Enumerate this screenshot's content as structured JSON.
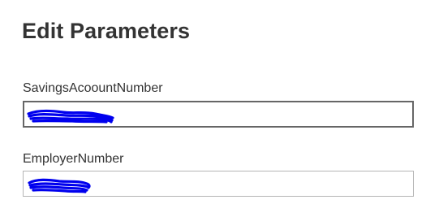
{
  "dialog": {
    "title": "Edit Parameters"
  },
  "fields": [
    {
      "label": "SavingsAcoountNumber",
      "value": ""
    },
    {
      "label": "EmployerNumber",
      "value": ""
    }
  ],
  "colors": {
    "title_text": "#333333",
    "label_text": "#333333",
    "focused_border": "#666666",
    "input_border": "#b4b4b4",
    "redaction_scribble": "#0000ee"
  }
}
